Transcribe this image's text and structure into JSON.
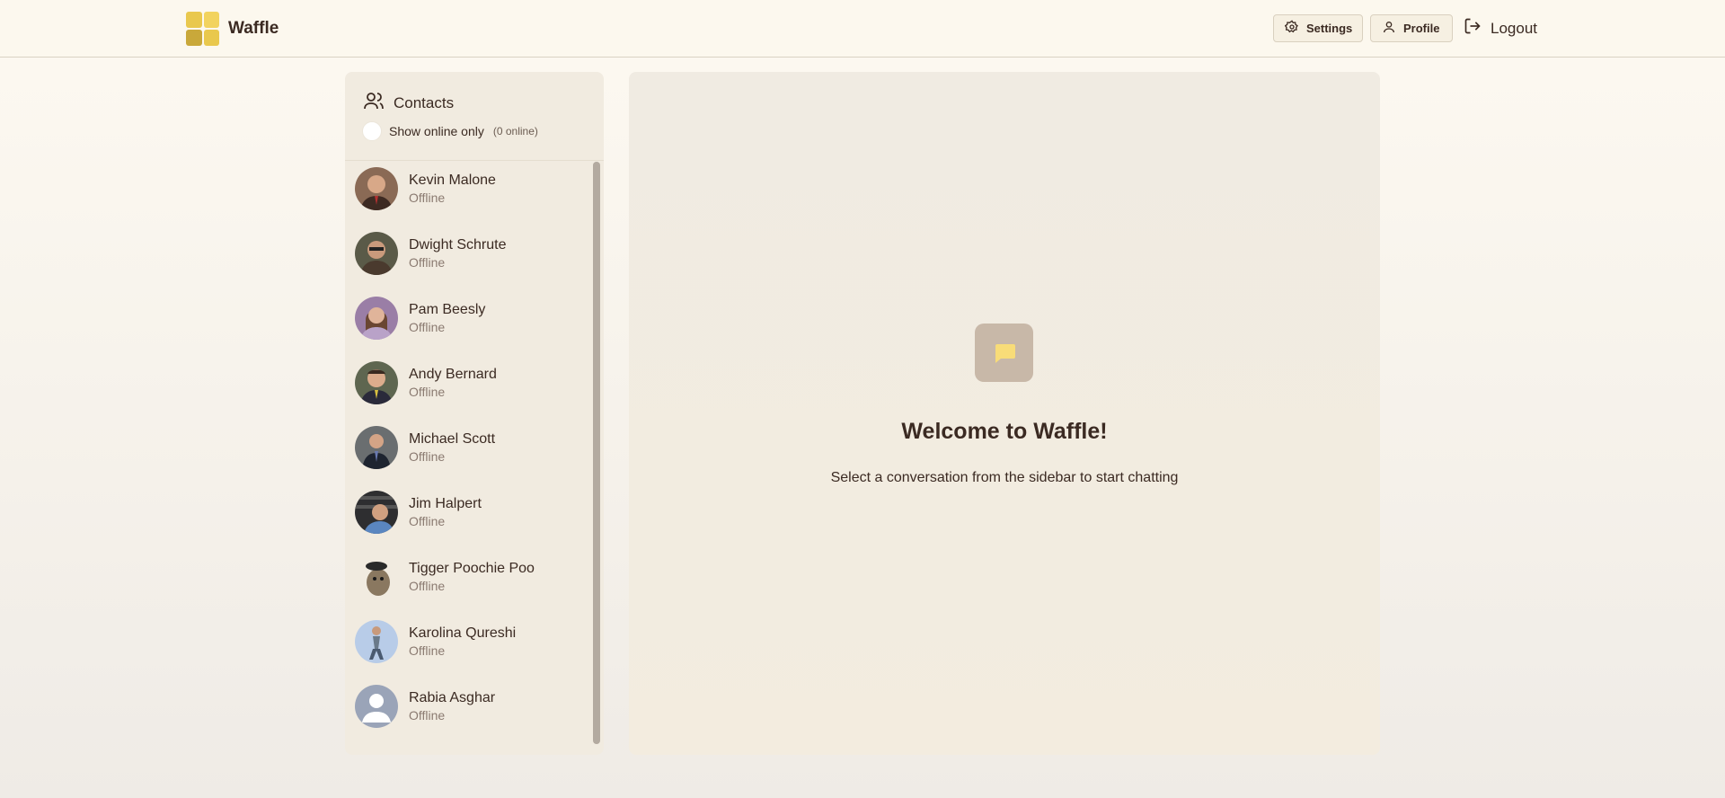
{
  "header": {
    "brand": "Waffle",
    "settings_label": "Settings",
    "profile_label": "Profile",
    "logout_label": "Logout"
  },
  "sidebar": {
    "title": "Contacts",
    "filter_label": "Show online only",
    "online_count": "(0 online)",
    "contacts": [
      {
        "name": "Kevin Malone",
        "status": "Offline"
      },
      {
        "name": "Dwight Schrute",
        "status": "Offline"
      },
      {
        "name": "Pam Beesly",
        "status": "Offline"
      },
      {
        "name": "Andy Bernard",
        "status": "Offline"
      },
      {
        "name": "Michael Scott",
        "status": "Offline"
      },
      {
        "name": "Jim Halpert",
        "status": "Offline"
      },
      {
        "name": "Tigger Poochie Poo",
        "status": "Offline"
      },
      {
        "name": "Karolina Qureshi",
        "status": "Offline"
      },
      {
        "name": "Rabia Asghar",
        "status": "Offline"
      }
    ]
  },
  "main": {
    "welcome_title": "Welcome to Waffle!",
    "welcome_subtitle": "Select a conversation from the sidebar to start chatting"
  },
  "colors": {
    "accent": "#e8c24a",
    "chat_icon_bg": "#c8b8a8",
    "text": "#3b2a22"
  }
}
